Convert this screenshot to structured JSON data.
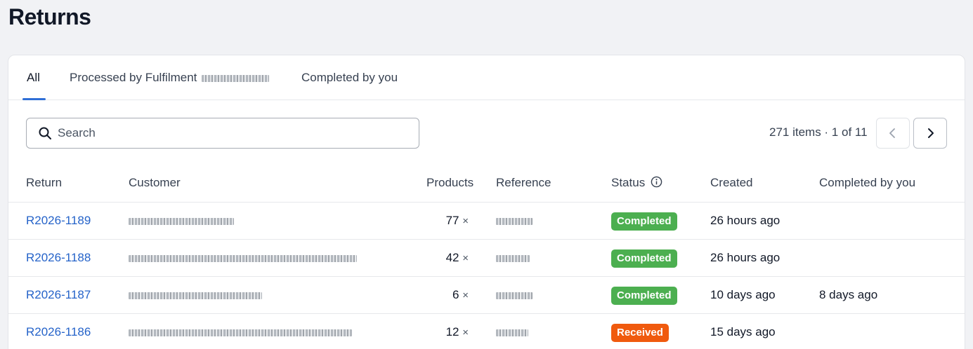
{
  "page": {
    "title": "Returns"
  },
  "tabs": [
    {
      "label": "All",
      "active": true
    },
    {
      "label": "Processed by Fulfilment",
      "active": false
    },
    {
      "label": "Completed by you",
      "active": false
    }
  ],
  "search": {
    "placeholder": "Search",
    "value": ""
  },
  "pagination": {
    "summary": "271 items · 1 of 11"
  },
  "table": {
    "columns": [
      "Return",
      "Customer",
      "Products",
      "Reference",
      "Status",
      "Created",
      "Completed by you"
    ],
    "rows": [
      {
        "return": "R2026-1189",
        "products": "77",
        "status": "Completed",
        "created": "26 hours ago",
        "completed_by_you": ""
      },
      {
        "return": "R2026-1188",
        "products": "42",
        "status": "Completed",
        "created": "26 hours ago",
        "completed_by_you": ""
      },
      {
        "return": "R2026-1187",
        "products": "6",
        "status": "Completed",
        "created": "10 days ago",
        "completed_by_you": "8 days ago"
      },
      {
        "return": "R2026-1186",
        "products": "12",
        "status": "Received",
        "created": "15 days ago",
        "completed_by_you": ""
      }
    ]
  },
  "symbols": {
    "times": "×"
  },
  "colors": {
    "status_completed": "#4caf50",
    "status_received": "#f05a0e",
    "link": "#2563c9",
    "tab_indicator": "#2f6fd6"
  },
  "icons": {
    "search": "search-icon",
    "prev": "chevron-left-icon",
    "next": "chevron-right-icon",
    "info": "info-icon"
  }
}
